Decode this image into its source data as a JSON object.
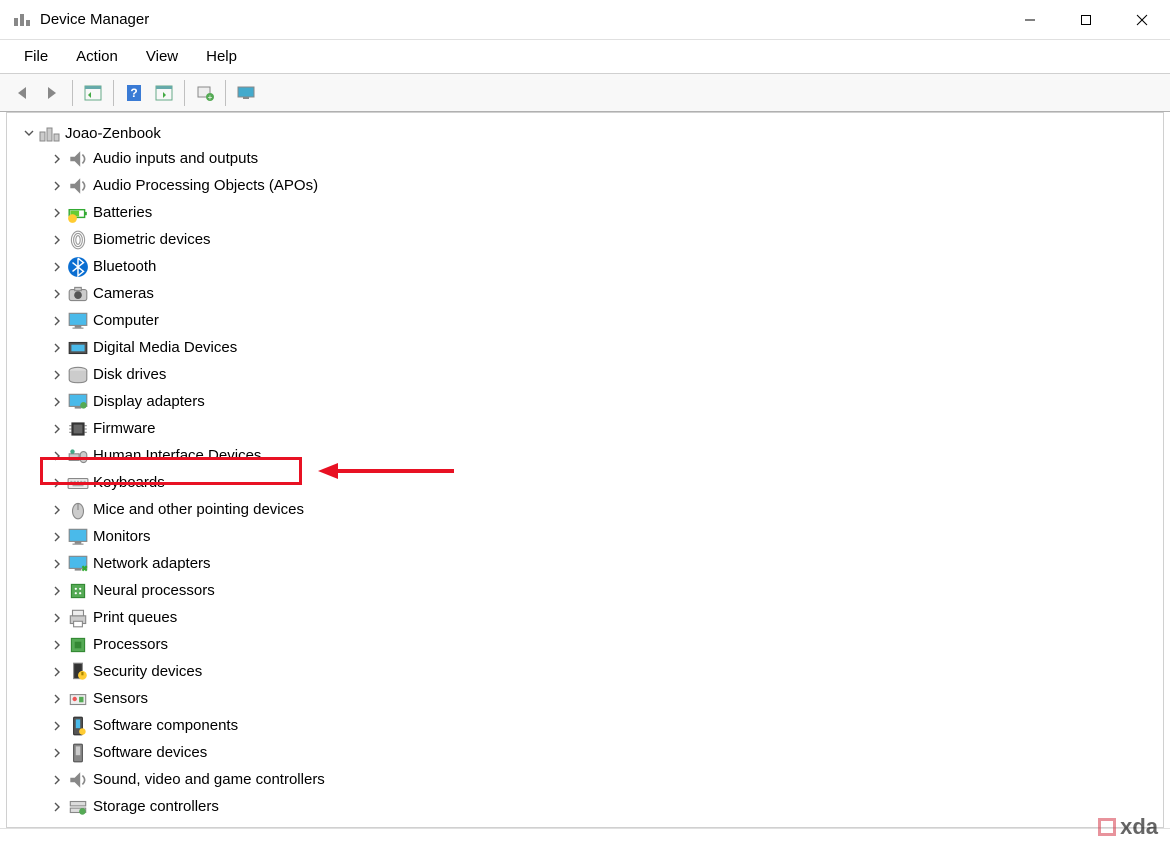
{
  "window": {
    "title": "Device Manager"
  },
  "menubar": {
    "items": [
      {
        "label": "File"
      },
      {
        "label": "Action"
      },
      {
        "label": "View"
      },
      {
        "label": "Help"
      }
    ]
  },
  "toolbar": {
    "buttons": [
      {
        "name": "back-button",
        "icon": "arrow-left"
      },
      {
        "name": "forward-button",
        "icon": "arrow-right"
      },
      {
        "name": "show-hide-tree-button",
        "icon": "tree-toggle"
      },
      {
        "name": "help-button",
        "icon": "help"
      },
      {
        "name": "properties-button",
        "icon": "properties"
      },
      {
        "name": "scan-hardware-button",
        "icon": "scan"
      },
      {
        "name": "monitors-button",
        "icon": "monitor"
      }
    ]
  },
  "tree": {
    "root": {
      "label": "Joao-Zenbook",
      "icon": "computer-root",
      "expanded": true
    },
    "items": [
      {
        "label": "Audio inputs and outputs",
        "icon": "audio"
      },
      {
        "label": "Audio Processing Objects (APOs)",
        "icon": "audio"
      },
      {
        "label": "Batteries",
        "icon": "battery"
      },
      {
        "label": "Biometric devices",
        "icon": "fingerprint"
      },
      {
        "label": "Bluetooth",
        "icon": "bluetooth"
      },
      {
        "label": "Cameras",
        "icon": "camera"
      },
      {
        "label": "Computer",
        "icon": "monitor-blue"
      },
      {
        "label": "Digital Media Devices",
        "icon": "media"
      },
      {
        "label": "Disk drives",
        "icon": "disk"
      },
      {
        "label": "Display adapters",
        "icon": "display"
      },
      {
        "label": "Firmware",
        "icon": "chip"
      },
      {
        "label": "Human Interface Devices",
        "icon": "hid",
        "highlighted": true
      },
      {
        "label": "Keyboards",
        "icon": "keyboard"
      },
      {
        "label": "Mice and other pointing devices",
        "icon": "mouse"
      },
      {
        "label": "Monitors",
        "icon": "monitor-blue"
      },
      {
        "label": "Network adapters",
        "icon": "network"
      },
      {
        "label": "Neural processors",
        "icon": "neural"
      },
      {
        "label": "Print queues",
        "icon": "printer"
      },
      {
        "label": "Processors",
        "icon": "cpu"
      },
      {
        "label": "Security devices",
        "icon": "security"
      },
      {
        "label": "Sensors",
        "icon": "sensor"
      },
      {
        "label": "Software components",
        "icon": "software"
      },
      {
        "label": "Software devices",
        "icon": "software-dev"
      },
      {
        "label": "Sound, video and game controllers",
        "icon": "sound"
      },
      {
        "label": "Storage controllers",
        "icon": "storage"
      }
    ]
  },
  "watermark": "xda"
}
